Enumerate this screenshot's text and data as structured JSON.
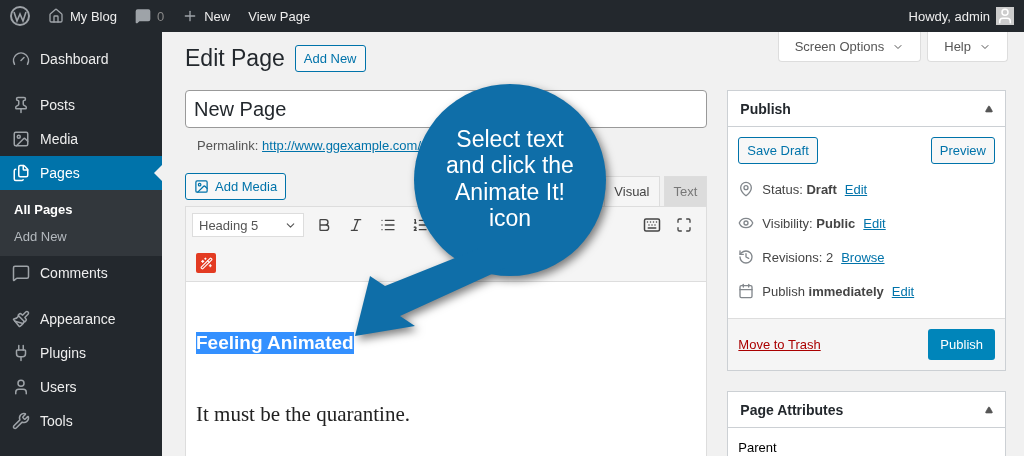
{
  "admin_bar": {
    "site": "My Blog",
    "comments": "0",
    "new": "New",
    "view": "View Page",
    "greeting": "Howdy, admin"
  },
  "sidebar": {
    "groups": [
      [
        {
          "label": "Dashboard",
          "selected": false
        }
      ],
      [
        {
          "label": "Posts",
          "selected": false
        },
        {
          "label": "Media",
          "selected": false
        },
        {
          "label": "Pages",
          "selected": true,
          "children": [
            {
              "label": "All Pages",
              "selected": true
            },
            {
              "label": "Add New",
              "selected": false
            }
          ]
        },
        {
          "label": "Comments",
          "selected": false
        }
      ],
      [
        {
          "label": "Appearance",
          "selected": false
        },
        {
          "label": "Plugins",
          "selected": false
        },
        {
          "label": "Users",
          "selected": false
        },
        {
          "label": "Tools",
          "selected": false
        }
      ]
    ]
  },
  "screen_tabs": [
    "Screen Options",
    "Help"
  ],
  "heading": "Edit Page",
  "add_new": "Add New",
  "title_field": {
    "value": "New Page"
  },
  "permalink": {
    "label": "Permalink:",
    "link": "http://www.ggexample.com/"
  },
  "editor": {
    "add_media": "Add Media",
    "tabs": [
      {
        "label": "Visual",
        "selected": true
      },
      {
        "label": "Text",
        "selected": false
      }
    ],
    "format": "Heading 5",
    "content": [
      {
        "kind": "heading",
        "text": "Feeling Animated",
        "highlighted": true
      },
      {
        "kind": "paragraph",
        "text": "It must be the quarantine.",
        "highlighted": false
      }
    ]
  },
  "publish": {
    "title": "Publish",
    "save_draft": "Save Draft",
    "preview": "Preview",
    "rows": [
      {
        "label": "Status:",
        "value": "Draft",
        "link": "Edit"
      },
      {
        "label": "Visibility:",
        "value": "Public",
        "link": "Edit"
      },
      {
        "label": "Revisions: 2",
        "link": "Browse"
      },
      {
        "label": "Publish",
        "value": "immediately",
        "link": "Edit"
      }
    ],
    "trash": "Move to Trash",
    "button": "Publish"
  },
  "page_attributes": {
    "title": "Page Attributes",
    "label": "Parent"
  },
  "callout": {
    "text": "Select text and click the Animate It! icon"
  }
}
